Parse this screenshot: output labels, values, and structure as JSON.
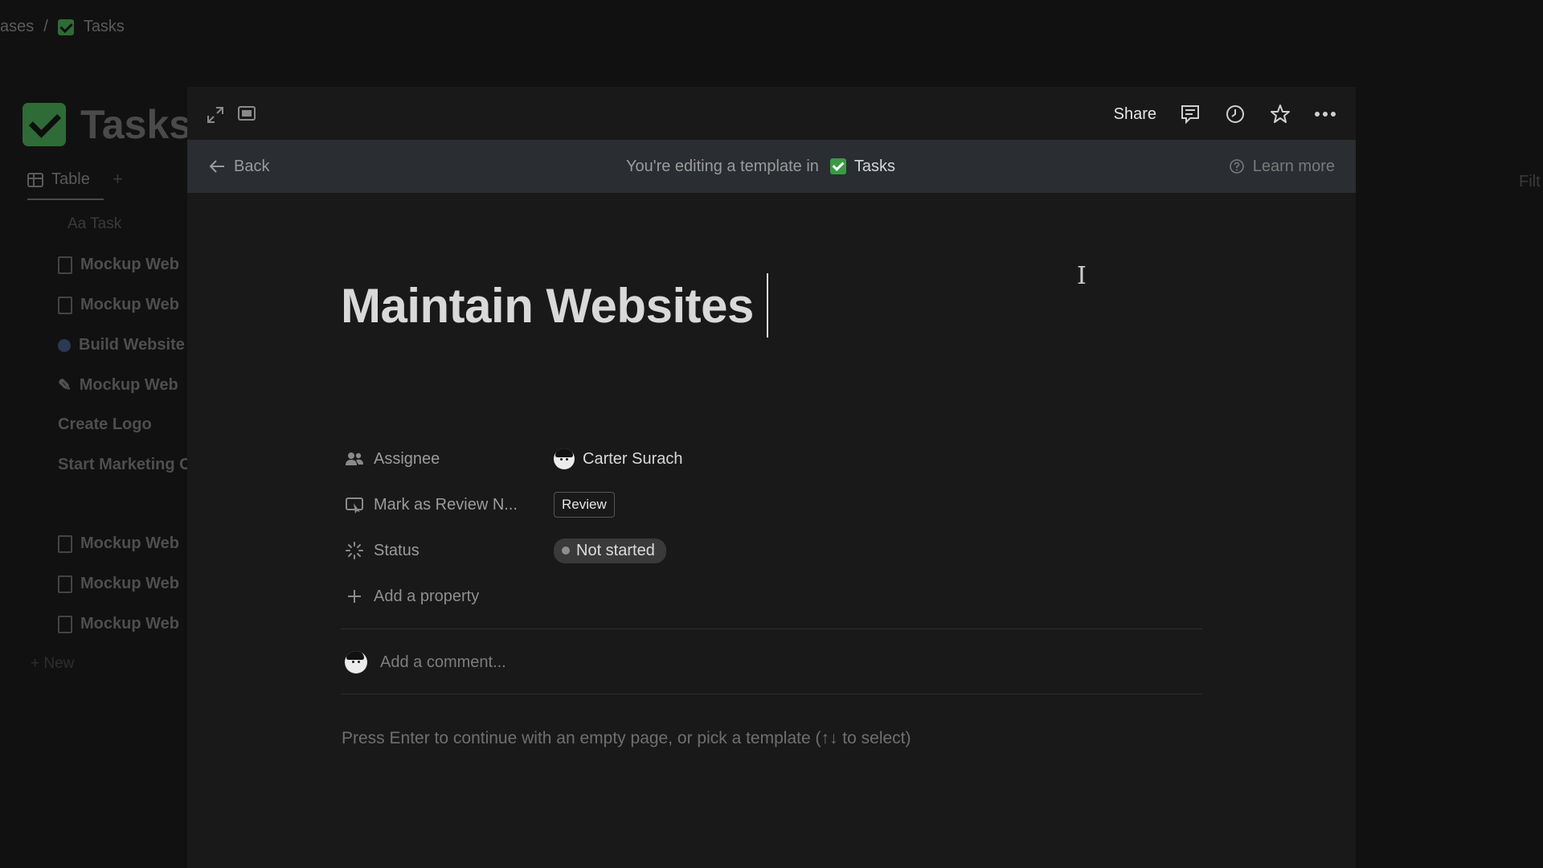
{
  "background": {
    "breadcrumb": [
      "ases",
      "/",
      "Tasks"
    ],
    "title": "Tasks",
    "view_tab": "Table",
    "view_add": "+",
    "column": "Aa Task",
    "rows": [
      {
        "label": "Mockup Web",
        "icon": "doc-icon"
      },
      {
        "label": "Mockup Web",
        "icon": "doc-icon"
      },
      {
        "label": "Build Website",
        "icon": "globe-icon"
      },
      {
        "label": "Mockup Web",
        "icon": "pencil-icon"
      },
      {
        "label": "Create Logo",
        "icon": ""
      },
      {
        "label": "Start Marketing C",
        "icon": ""
      },
      {
        "label": "Mockup Web",
        "icon": "doc-icon"
      },
      {
        "label": "Mockup Web",
        "icon": "doc-icon"
      },
      {
        "label": "Mockup Web",
        "icon": "doc-icon"
      }
    ],
    "new_label": "+ New",
    "right_cut": "Filt"
  },
  "topbar": {
    "share_label": "Share",
    "icons": [
      "expand-icon",
      "side-peek-icon",
      "comment-icon",
      "history-icon",
      "star-icon",
      "more-icon"
    ]
  },
  "banner": {
    "back_label": "Back",
    "editing_text": "You're editing a template in",
    "database_name": "Tasks",
    "learn_more_label": "Learn more"
  },
  "page": {
    "title": "Maintain Websites",
    "properties": {
      "assignee": {
        "label": "Assignee",
        "value": "Carter Surach"
      },
      "review": {
        "label": "Mark as Review N...",
        "button_label": "Review"
      },
      "status": {
        "label": "Status",
        "value": "Not started"
      },
      "add_property_label": "Add a property"
    },
    "comment_placeholder": "Add a comment...",
    "hint": "Press Enter to continue with an empty page, or pick a template (↑↓ to select)"
  },
  "colors": {
    "background": "#0e0e0e",
    "modal": "#191919",
    "banner": "#2a2d31",
    "check_green": "#3a9a44",
    "status_pill": "#3a3a3a"
  }
}
